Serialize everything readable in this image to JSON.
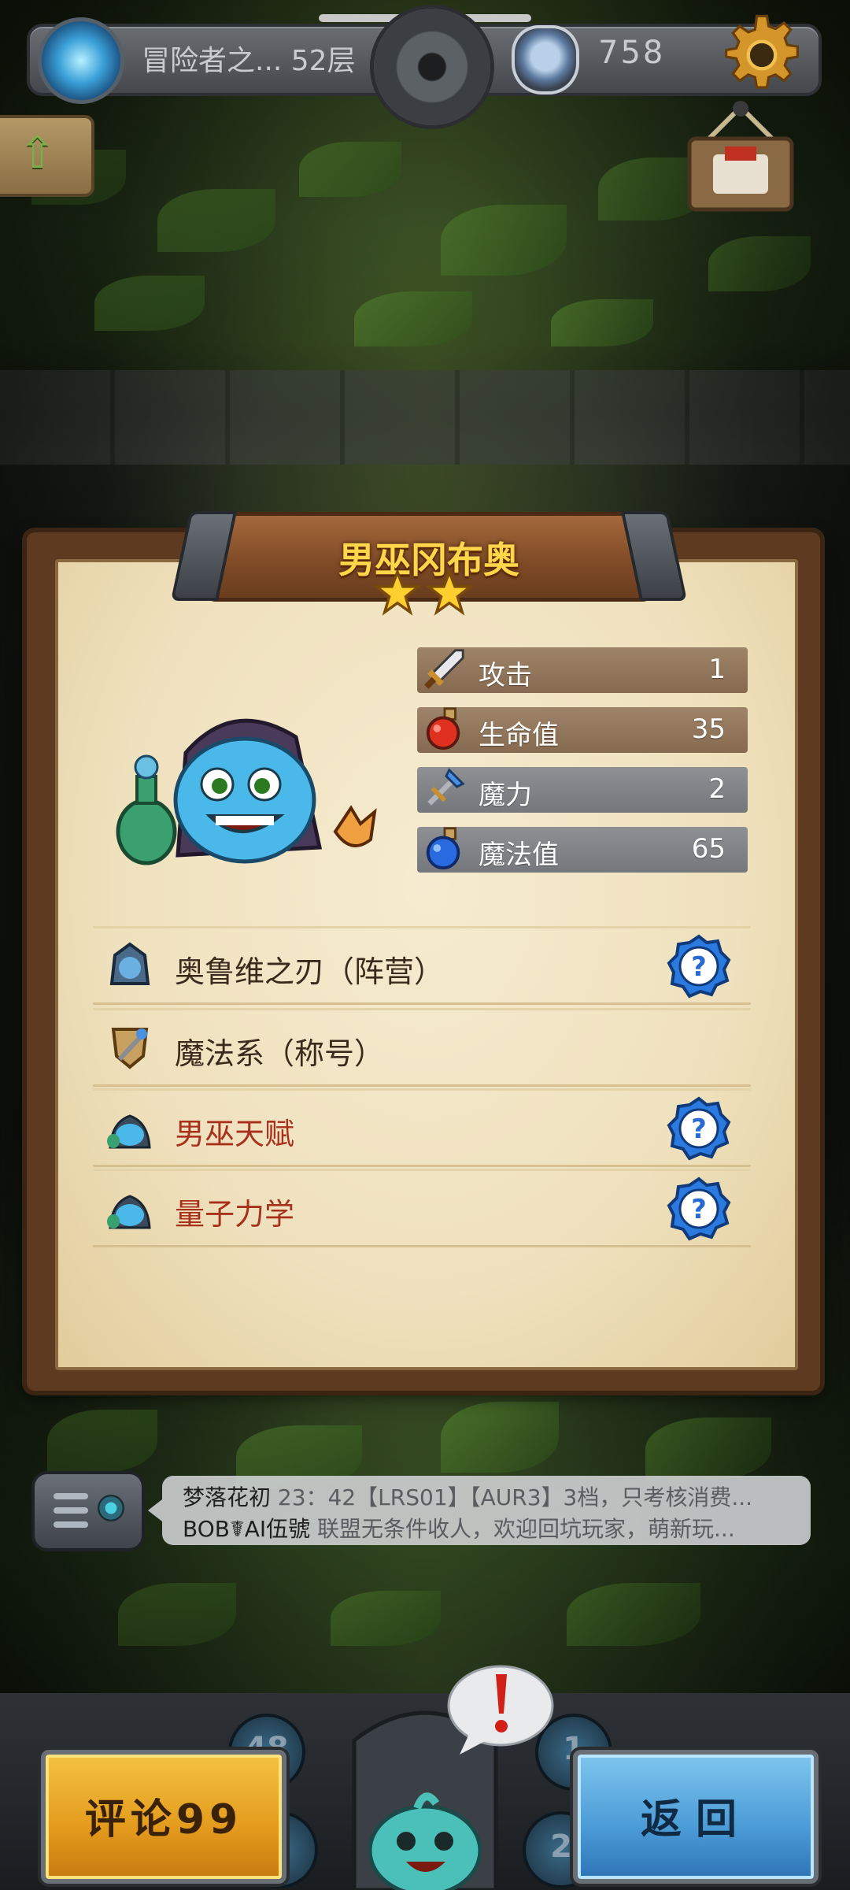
{
  "top_bar": {
    "floor_text": "冒险者之... 52层",
    "gem_count": "758"
  },
  "unit": {
    "name": "男巫冈布奥",
    "stars": 2
  },
  "stats": {
    "attack": {
      "label": "攻击",
      "value": "1"
    },
    "hp": {
      "label": "生命值",
      "value": "35"
    },
    "magic": {
      "label": "魔力",
      "value": "2"
    },
    "mp": {
      "label": "魔法值",
      "value": "65"
    }
  },
  "traits": [
    {
      "label": "奥鲁维之刃（阵营）",
      "help": true,
      "color": "#3a2a1c"
    },
    {
      "label": "魔法系（称号）",
      "help": false,
      "color": "#3a2a1c"
    },
    {
      "label": "男巫天赋",
      "help": true,
      "color": "#a8301c"
    },
    {
      "label": "量子力学",
      "help": true,
      "color": "#a8301c"
    }
  ],
  "chat": {
    "messages": [
      {
        "name": "梦落花初",
        "text": "23：42【LRS01】【AUR3】3档，只考核消费..."
      },
      {
        "name": "BOB☤AI伍號",
        "text": "联盟无条件收人，欢迎回坑玩家，萌新玩..."
      }
    ]
  },
  "bottom": {
    "comment_button": "评论99",
    "return_button": "返回",
    "left_badge": "48",
    "left_badge_2": "8",
    "right_badge": "1",
    "right_badge_2": "2"
  },
  "icons": {
    "portal": "portal-icon",
    "gem": "gem-icon",
    "settings": "gear-icon",
    "back": "up-arrow-icon",
    "shop": "shop-sign-icon"
  }
}
